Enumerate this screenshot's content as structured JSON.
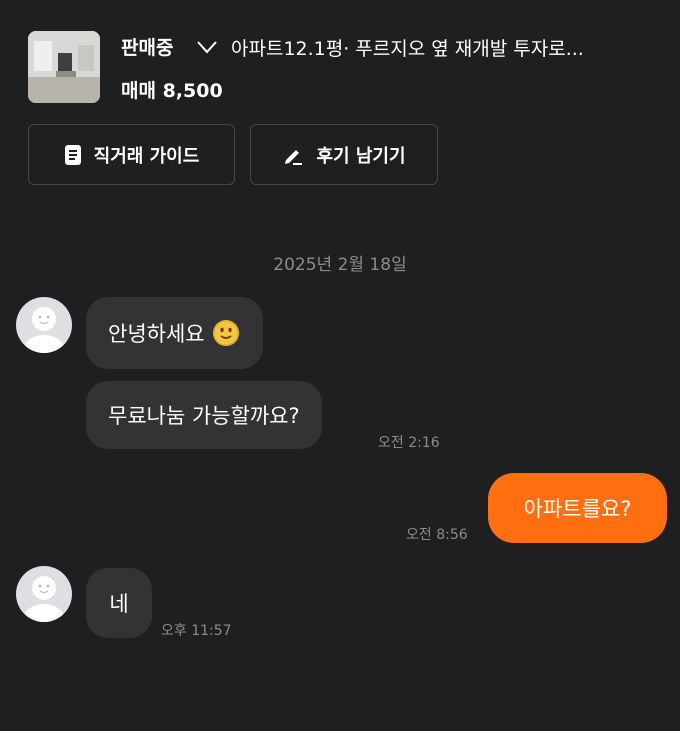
{
  "listing": {
    "status": "판매중",
    "title": "아파트12.1평· 푸르지오 옆 재개발 투자로...",
    "price": "매매 8,500"
  },
  "buttons": {
    "guide_label": "직거래 가이드",
    "review_label": "후기 남기기"
  },
  "chat": {
    "date": "2025년 2월 18일",
    "messages": [
      {
        "sender": "other",
        "text": "안녕하세요",
        "emoji": "slightly-smiling-face-emoji"
      },
      {
        "sender": "other",
        "text": "무료나눔 가능할까요?",
        "time": "오전 2:16"
      },
      {
        "sender": "me",
        "text": "아파트를요?",
        "time": "오전 8:56"
      },
      {
        "sender": "other",
        "text": "네",
        "time": "오후 11:57"
      }
    ]
  },
  "colors": {
    "background": "#1f1f21",
    "incoming_bubble": "#333336",
    "outgoing_bubble": "#ff6f0f",
    "muted_text": "#8c8c90"
  },
  "icons": [
    "chevron-down-icon",
    "document-icon",
    "pencil-icon",
    "default-avatar-icon"
  ]
}
